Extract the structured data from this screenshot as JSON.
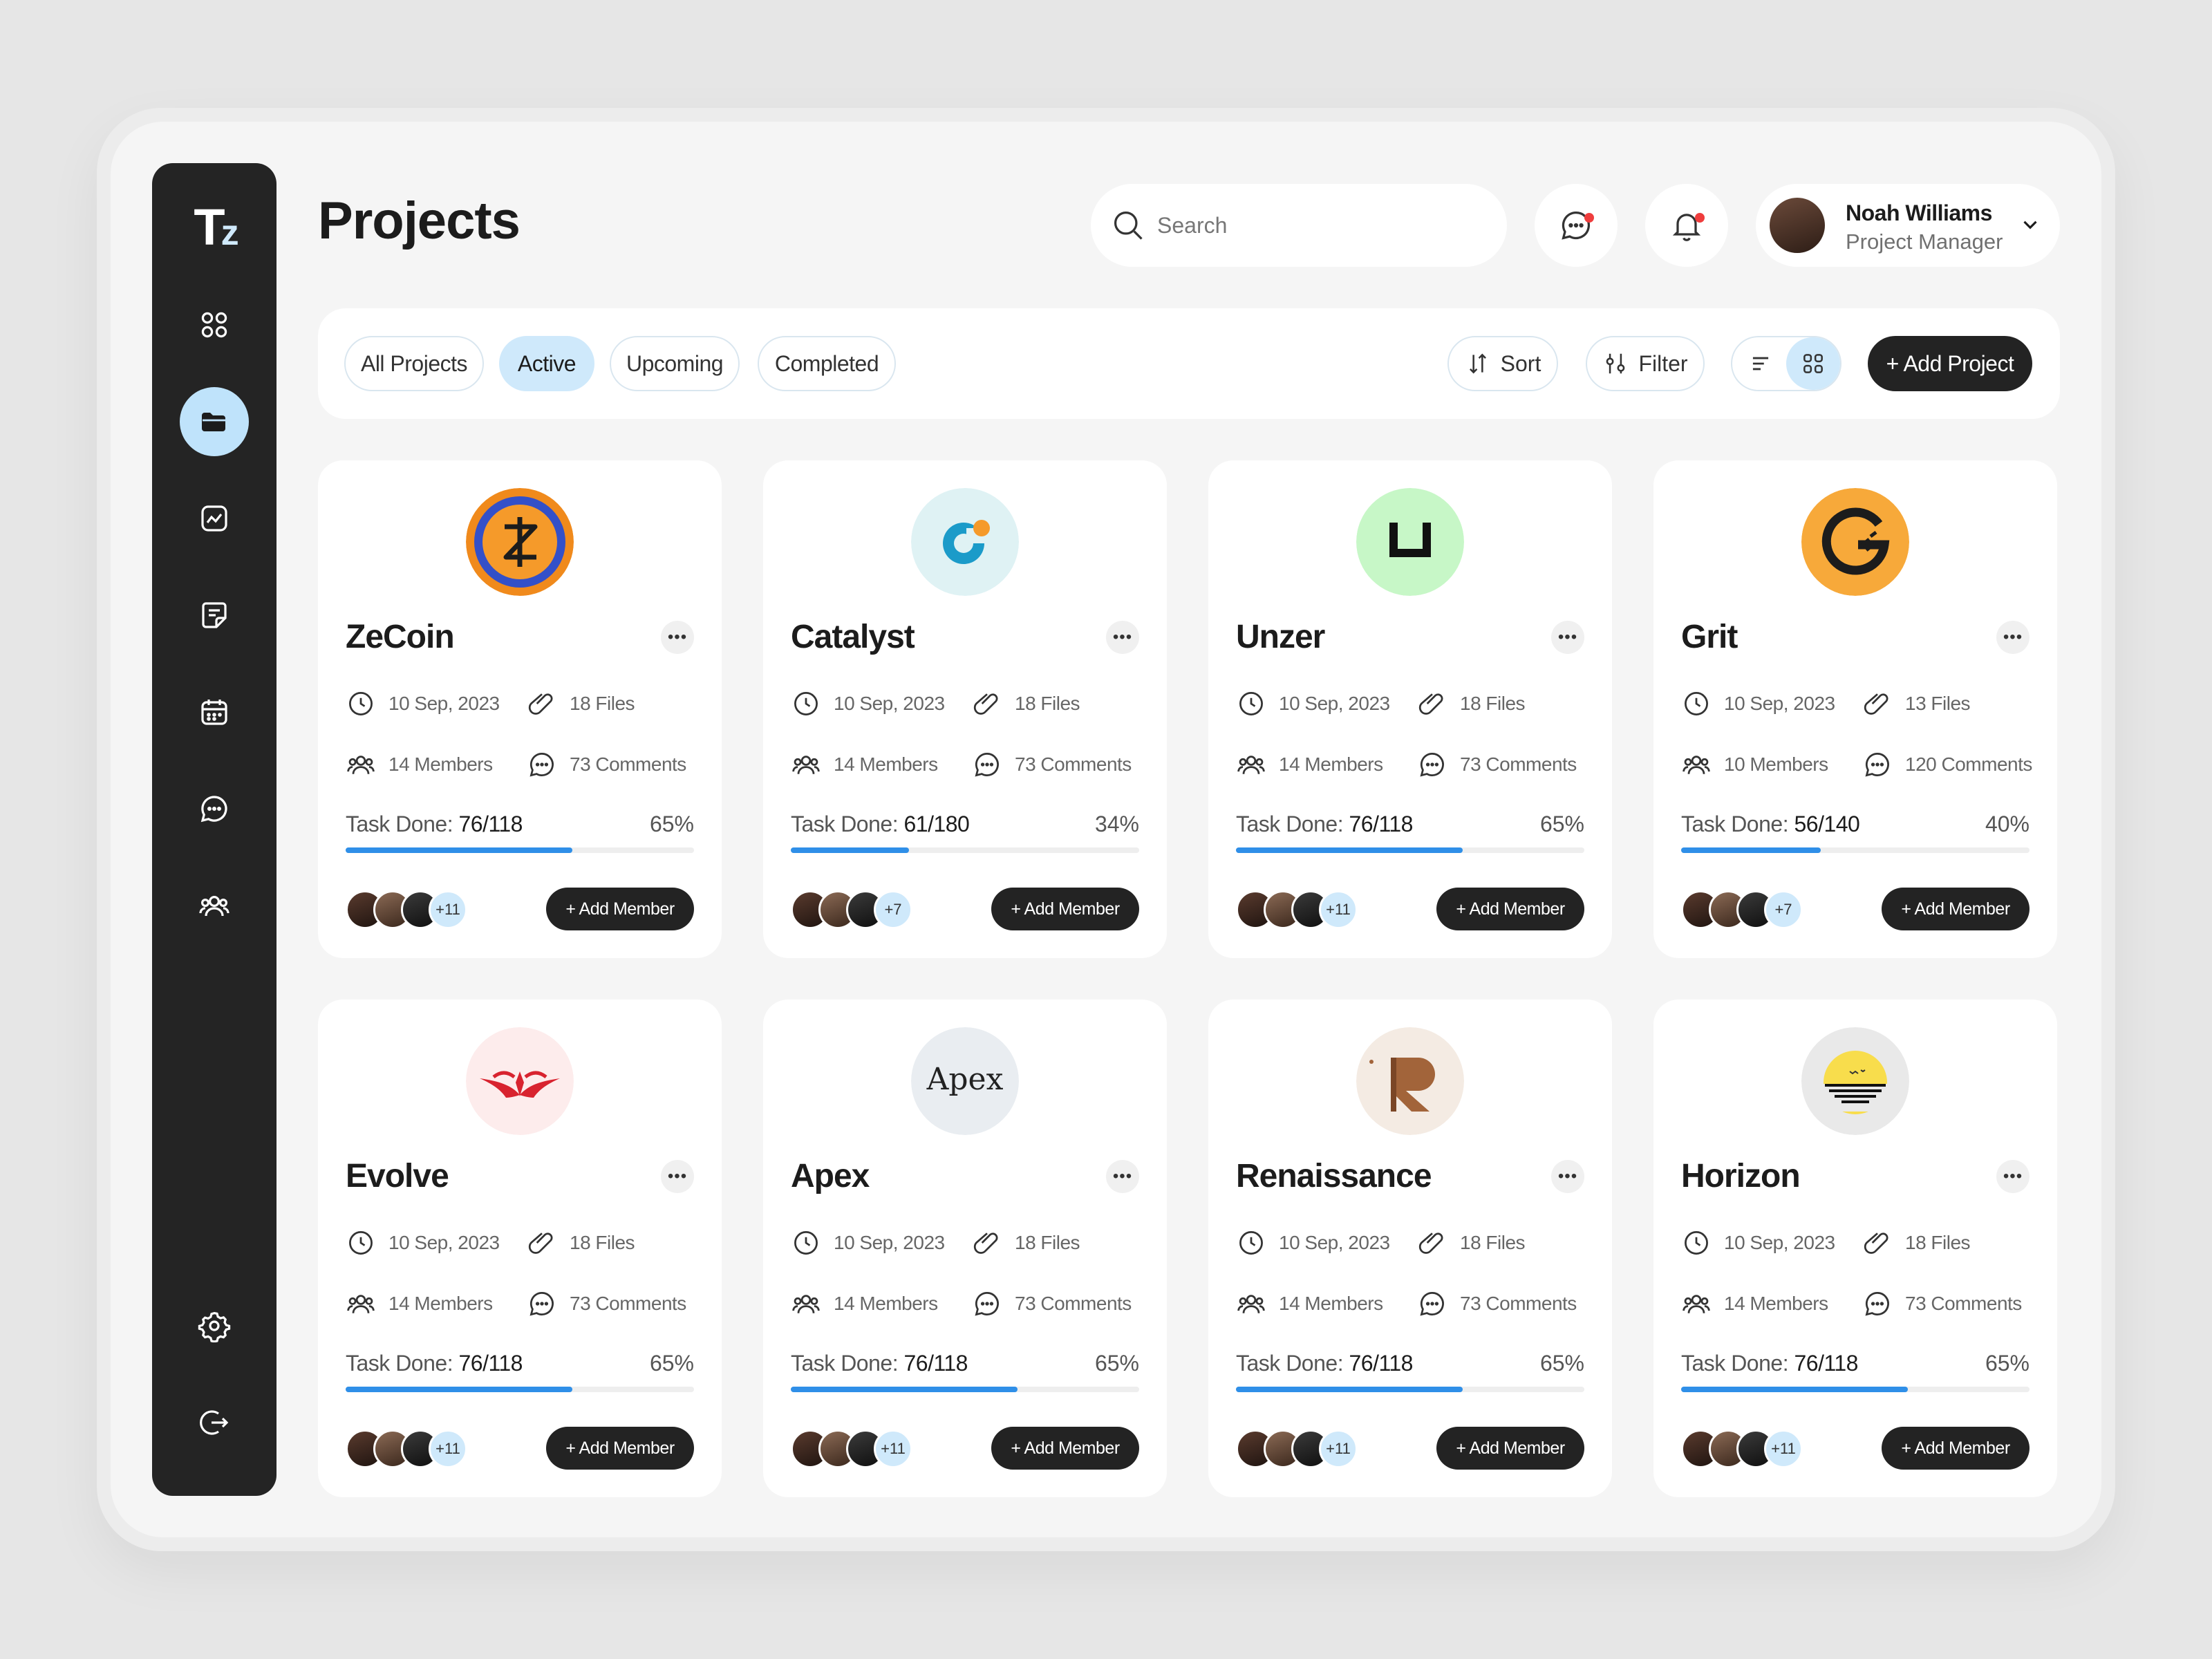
{
  "app": {
    "logo": "T",
    "logo_sub": "z"
  },
  "page_title": "Projects",
  "search": {
    "placeholder": "Search"
  },
  "user": {
    "name": "Noah Williams",
    "role": "Project Manager"
  },
  "tabs": [
    "All Projects",
    "Active",
    "Upcoming",
    "Completed"
  ],
  "active_tab": "Active",
  "toolbar": {
    "sort_label": "Sort",
    "filter_label": "Filter",
    "add_project_label": "+ Add Project"
  },
  "colors": {
    "accent_blue": "#2f8fe8",
    "active_pill": "#cfe9fb",
    "dark": "#232323",
    "notification": "#ef3d3d"
  },
  "projects": [
    {
      "name": "ZeCoin",
      "date": "10 Sep, 2023",
      "files": "18 Files",
      "members": "14 Members",
      "comments": "73 Comments",
      "task_label": "Task Done:",
      "task_value": "76/118",
      "percent_text": "65%",
      "progress": 0.65,
      "extra_members": "+11",
      "add_member_label": "+ Add Member",
      "logo_icon": "zecoin-logo"
    },
    {
      "name": "Catalyst",
      "date": "10 Sep, 2023",
      "files": "18 Files",
      "members": "14 Members",
      "comments": "73 Comments",
      "task_label": "Task Done:",
      "task_value": "61/180",
      "percent_text": "34%",
      "progress": 0.34,
      "extra_members": "+7",
      "add_member_label": "+ Add Member",
      "logo_icon": "catalyst-logo"
    },
    {
      "name": "Unzer",
      "date": "10 Sep, 2023",
      "files": "18 Files",
      "members": "14 Members",
      "comments": "73 Comments",
      "task_label": "Task Done:",
      "task_value": "76/118",
      "percent_text": "65%",
      "progress": 0.65,
      "extra_members": "+11",
      "add_member_label": "+ Add Member",
      "logo_icon": "unzer-logo"
    },
    {
      "name": "Grit",
      "date": "10 Sep, 2023",
      "files": "13 Files",
      "members": "10 Members",
      "comments": "120 Comments",
      "task_label": "Task Done:",
      "task_value": "56/140",
      "percent_text": "40%",
      "progress": 0.4,
      "extra_members": "+7",
      "add_member_label": "+ Add Member",
      "logo_icon": "grit-logo"
    },
    {
      "name": "Evolve",
      "date": "10 Sep, 2023",
      "files": "18 Files",
      "members": "14 Members",
      "comments": "73 Comments",
      "task_label": "Task Done:",
      "task_value": "76/118",
      "percent_text": "65%",
      "progress": 0.65,
      "extra_members": "+11",
      "add_member_label": "+ Add Member",
      "logo_icon": "evolve-logo"
    },
    {
      "name": "Apex",
      "date": "10 Sep, 2023",
      "files": "18 Files",
      "members": "14 Members",
      "comments": "73 Comments",
      "task_label": "Task Done:",
      "task_value": "76/118",
      "percent_text": "65%",
      "progress": 0.65,
      "extra_members": "+11",
      "add_member_label": "+ Add Member",
      "logo_icon": "apex-logo",
      "logo_text": "Apex"
    },
    {
      "name": "Renaissance",
      "date": "10 Sep, 2023",
      "files": "18 Files",
      "members": "14 Members",
      "comments": "73 Comments",
      "task_label": "Task Done:",
      "task_value": "76/118",
      "percent_text": "65%",
      "progress": 0.65,
      "extra_members": "+11",
      "add_member_label": "+ Add Member",
      "logo_icon": "renaissance-logo"
    },
    {
      "name": "Horizon",
      "date": "10 Sep, 2023",
      "files": "18 Files",
      "members": "14 Members",
      "comments": "73 Comments",
      "task_label": "Task Done:",
      "task_value": "76/118",
      "percent_text": "65%",
      "progress": 0.65,
      "extra_members": "+11",
      "add_member_label": "+ Add Member",
      "logo_icon": "horizon-logo"
    }
  ]
}
